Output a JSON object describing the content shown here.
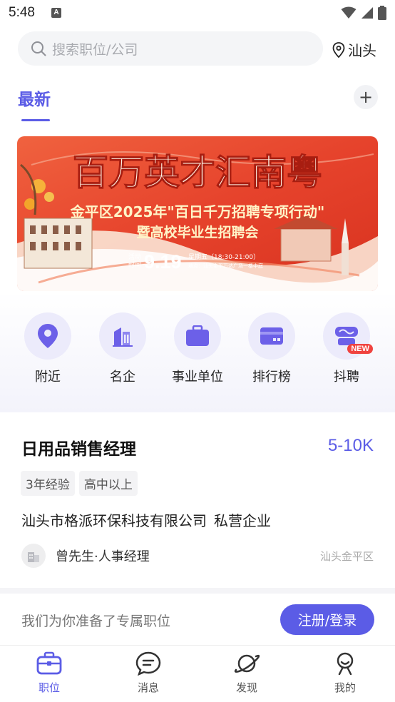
{
  "status_bar": {
    "time": "5:48",
    "notification_icon": "A"
  },
  "search": {
    "placeholder": "搜索职位/公司"
  },
  "location": {
    "city": "汕头"
  },
  "tabs": {
    "latest": "最新",
    "add": "+"
  },
  "banner": {
    "headline": "百万英才汇南粤",
    "subtitle_line1": "金平区2025年\"百日千万招聘专项行动\"",
    "subtitle_line2": "暨高校毕业生招聘会",
    "time_label_1": "活动",
    "time_label_2": "时间",
    "date": "9.19",
    "weekday_time": "星期五（18:30-21:00）",
    "venue": "地点：汕头金平万达广场一楼中庭",
    "colors": {
      "primary": "#e8432d",
      "gold": "#f5d97a"
    }
  },
  "quick_links": [
    {
      "label": "附近",
      "icon": "location-pin-icon"
    },
    {
      "label": "名企",
      "icon": "building-icon"
    },
    {
      "label": "事业单位",
      "icon": "briefcase-icon"
    },
    {
      "label": "排行榜",
      "icon": "card-icon"
    },
    {
      "label": "抖聘",
      "icon": "douyin-recruit-icon",
      "badge": "NEW"
    }
  ],
  "job": {
    "title": "日用品销售经理",
    "salary": "5-10K",
    "tags": [
      "3年经验",
      "高中以上"
    ],
    "company": "汕头市格派环保科技有限公司",
    "company_type": "私营企业",
    "recruiter": "曾先生·人事经理",
    "location": "汕头金平区"
  },
  "login_bar": {
    "text": "我们为你准备了专属职位",
    "button": "注册/登录"
  },
  "bottom_nav": [
    {
      "label": "职位",
      "icon": "briefcase-nav-icon",
      "active": true
    },
    {
      "label": "消息",
      "icon": "message-icon",
      "active": false
    },
    {
      "label": "发现",
      "icon": "planet-icon",
      "active": false
    },
    {
      "label": "我的",
      "icon": "profile-icon",
      "active": false
    }
  ],
  "colors": {
    "accent": "#5b5ce6",
    "badge": "#f0433f"
  }
}
